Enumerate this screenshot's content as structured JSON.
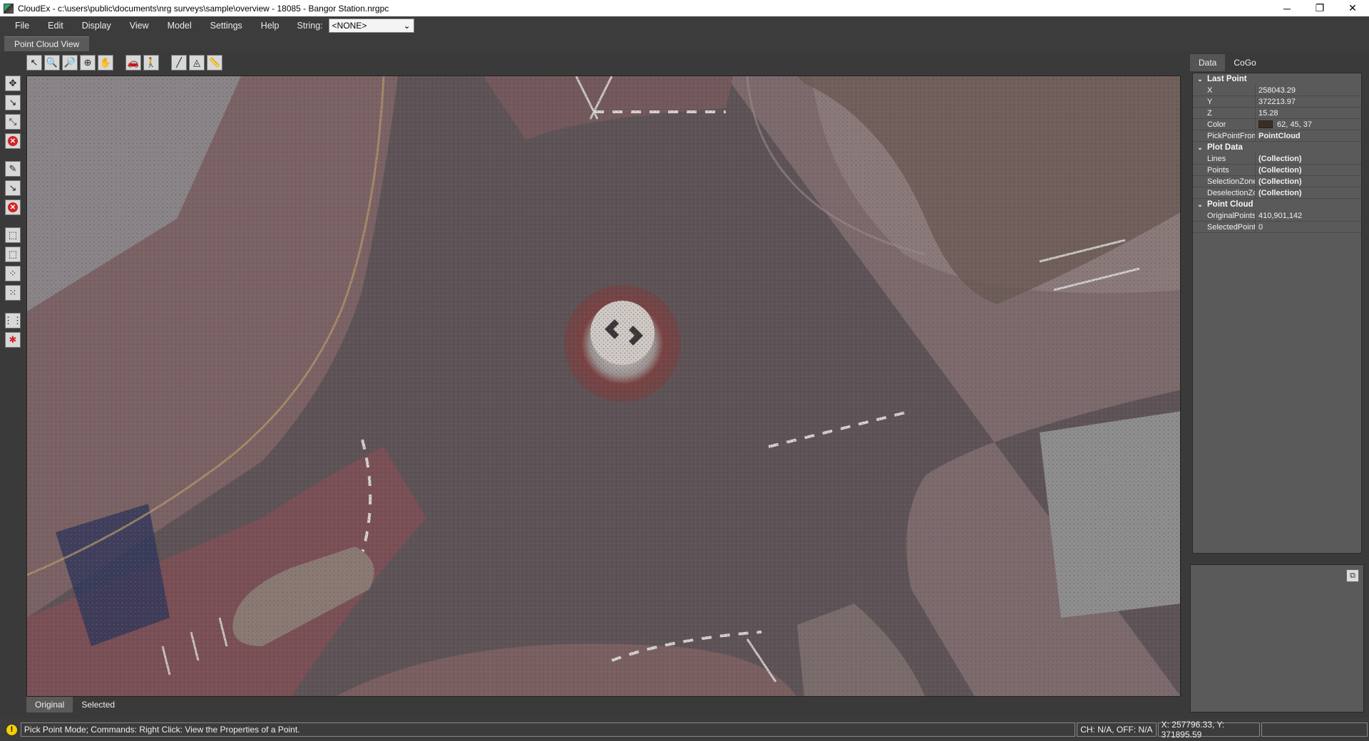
{
  "window": {
    "title": "CloudEx - c:\\users\\public\\documents\\nrg surveys\\sample\\overview - 18085 - Bangor Station.nrgpc",
    "minimize": "─",
    "maximize": "❐",
    "close": "✕"
  },
  "menu": {
    "items": [
      "File",
      "Edit",
      "Display",
      "View",
      "Model",
      "Settings",
      "Help"
    ],
    "string_label": "String:",
    "string_value": "<NONE>"
  },
  "doc_tab": {
    "label": "Point Cloud View"
  },
  "view_tabs": [
    "Original",
    "Selected"
  ],
  "panel": {
    "tabs": [
      "Data",
      "CoGo"
    ],
    "categories": {
      "last_point": "Last Point",
      "plot_data": "Plot Data",
      "point_cloud": "Point Cloud"
    },
    "last_point": {
      "x_key": "X",
      "x": "258043.29",
      "y_key": "Y",
      "y": "372213.97",
      "z_key": "Z",
      "z": "15.28",
      "color_key": "Color",
      "color": "62, 45, 37",
      "pick_key": "PickPointFrom",
      "pick": "PointCloud"
    },
    "plot_data": {
      "lines_key": "Lines",
      "lines": "(Collection)",
      "points_key": "Points",
      "points": "(Collection)",
      "sel_key": "SelectionZones",
      "sel": "(Collection)",
      "desel_key": "DeselectionZones",
      "desel": "(Collection)"
    },
    "point_cloud": {
      "orig_key": "OriginalPoints",
      "orig": "410,901,142",
      "selp_key": "SelectedPoints",
      "selp": "0"
    }
  },
  "status": {
    "message": "Pick Point Mode; Commands: Right Click: View the Properties of a Point.",
    "ch": "CH: N/A, OFF: N/A",
    "xy": "X: 257796.33, Y: 371895.59"
  },
  "colors": {
    "swatch": "#3e2d25"
  }
}
